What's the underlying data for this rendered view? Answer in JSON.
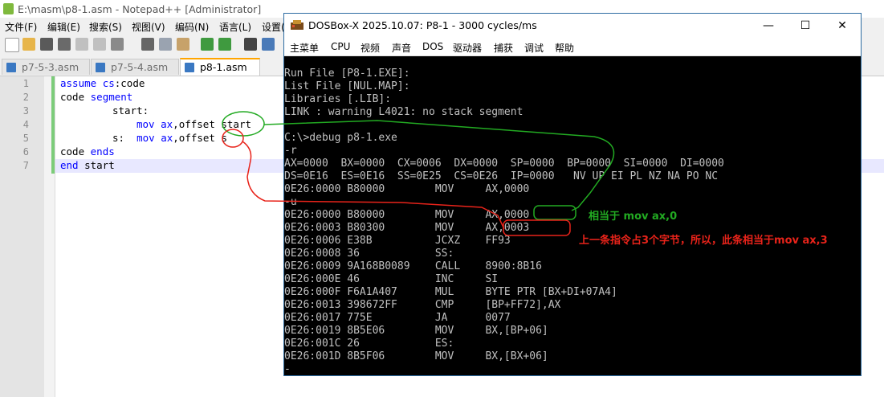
{
  "npp": {
    "title": "E:\\masm\\p8-1.asm - Notepad++ [Administrator]",
    "menu": [
      "文件(F)",
      "编辑(E)",
      "搜索(S)",
      "视图(V)",
      "编码(N)",
      "语言(L)",
      "设置("
    ],
    "tabs": [
      {
        "label": "p7-5-3.asm",
        "active": false
      },
      {
        "label": "p7-5-4.asm",
        "active": false
      },
      {
        "label": "p8-1.asm",
        "active": true
      }
    ],
    "line_numbers": [
      "1",
      "2",
      "3",
      "4",
      "5",
      "6",
      "7"
    ],
    "code": {
      "l1_kw": "assume",
      "l1_rest1": " ",
      "l1_kw2": "cs",
      "l1_rest2": ":code",
      "l2_rest1": "code ",
      "l2_kw": "segment",
      "l3": "start:",
      "l4_kw": "mov",
      "l4_sp": " ",
      "l4_kw2": "ax",
      "l4_rest": ",offset start",
      "l5_lbl": "s:  ",
      "l5_kw": "mov",
      "l5_sp": " ",
      "l5_kw2": "ax",
      "l5_rest": ",offset s",
      "l6_rest": "code ",
      "l6_kw": "ends",
      "l7_kw": "end",
      "l7_rest": " start"
    }
  },
  "dosbox": {
    "title": "DOSBox-X 2025.10.07: P8-1 - 3000 cycles/ms",
    "menu": [
      "主菜单",
      "CPU",
      "视频",
      "声音",
      "DOS",
      "驱动器",
      "捕获",
      "调试",
      "帮助"
    ],
    "lines": [
      "Run File [P8-1.EXE]:",
      "List File [NUL.MAP]:",
      "Libraries [.LIB]:",
      "LINK : warning L4021: no stack segment",
      "",
      "C:\\>debug p8-1.exe",
      "-r",
      "AX=0000  BX=0000  CX=0006  DX=0000  SP=0000  BP=0000  SI=0000  DI=0000",
      "DS=0E16  ES=0E16  SS=0E25  CS=0E26  IP=0000   NV UP EI PL NZ NA PO NC",
      "0E26:0000 B80000        MOV     AX,0000",
      "-u",
      "0E26:0000 B80000        MOV     AX,0000",
      "0E26:0003 B80300        MOV     AX,0003",
      "0E26:0006 E38B          JCXZ    FF93",
      "0E26:0008 36            SS:",
      "0E26:0009 9A168B0089    CALL    8900:8B16",
      "0E26:000E 46            INC     SI",
      "0E26:000F F6A1A407      MUL     BYTE PTR [BX+DI+07A4]",
      "0E26:0013 398672FF      CMP     [BP+FF72],AX",
      "0E26:0017 775E          JA      0077",
      "0E26:0019 8B5E06        MOV     BX,[BP+06]",
      "0E26:001C 26            ES:",
      "0E26:001D 8B5F06        MOV     BX,[BX+06]",
      "-"
    ]
  },
  "annotations": {
    "green_note": "相当于 mov ax,0",
    "red_note": "上一条指令占3个字节，所以，此条相当于mov ax,3",
    "green_color": "#22aa22",
    "red_color": "#e8231a"
  }
}
